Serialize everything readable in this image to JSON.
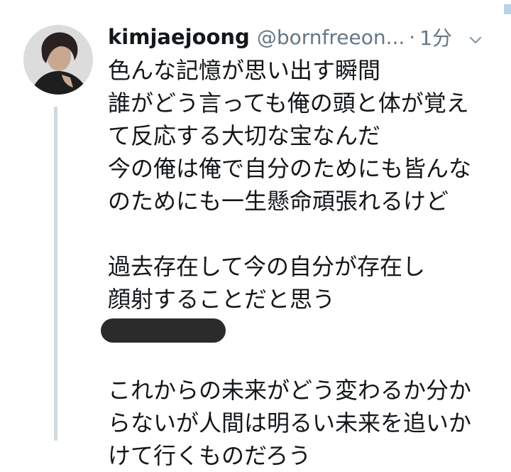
{
  "tweet": {
    "display_name": "kimjaejoong",
    "handle": "@bornfreeon...",
    "separator": "·",
    "time": "1分",
    "lines_part1": [
      "色んな記憶が思い出す瞬間",
      "誰がどう言っても俺の頭と体が覚え",
      "て反応する大切な宝なんだ",
      "今の俺は俺で自分のためにも皆んな",
      "のためにも一生懸命頑張れるけど"
    ],
    "lines_part2": [
      "過去存在して今の自分が存在し",
      "顔射することだと思う"
    ],
    "lines_part3": [
      "これからの未来がどう変わるか分か",
      "らないが人間は明るい未来を追いか",
      "けて行くものだろう"
    ]
  },
  "icons": {
    "avatar": "profile-photo",
    "menu": "chevron-down-icon"
  },
  "colors": {
    "text": "#14171a",
    "secondary": "#657786",
    "thread_line": "#cfd9de",
    "redaction": "#2b2b2b"
  }
}
